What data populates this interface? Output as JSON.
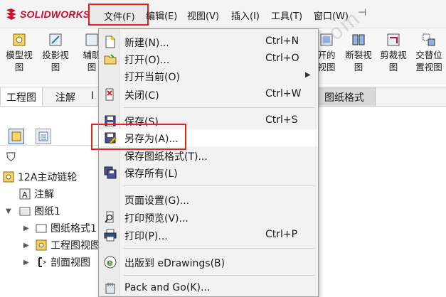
{
  "app": {
    "logo_text": "SOLIDWORKS",
    "brand_color": "#c8102e"
  },
  "menubar": {
    "file": "文件(F)",
    "edit": "编辑(E)",
    "view": "视图(V)",
    "insert": "插入(I)",
    "tools": "工具(T)",
    "window": "窗口(W)",
    "pin_icon": "pin-icon"
  },
  "ribbon": [
    {
      "line1": "模型视",
      "line2": "图"
    },
    {
      "line1": "投影视",
      "line2": "图"
    },
    {
      "line1": "辅助",
      "line2": "图"
    },
    {
      "line1": "开的",
      "line2": "视图"
    },
    {
      "line1": "断裂视",
      "line2": "图"
    },
    {
      "line1": "剪裁视",
      "line2": "图"
    },
    {
      "line1": "交替位",
      "line2": "置视图"
    }
  ],
  "tabs": {
    "drawing": "工程图",
    "annotation": "注解",
    "partial": "I",
    "sheet_format": "图纸格式"
  },
  "tree": {
    "root": "12A主动链轮",
    "annotations": "注解",
    "sheet": "图纸1",
    "sheet_format": "图纸格式1",
    "drawing_view": "工程图视图",
    "section_view": "剖面视图"
  },
  "file_menu": {
    "items": [
      {
        "label": "新建(N)...",
        "shortcut": "Ctrl+N",
        "icon": "new-document-icon"
      },
      {
        "label": "打开(O)...",
        "shortcut": "Ctrl+O",
        "icon": "open-folder-icon"
      },
      {
        "label": "打开当前(O)",
        "shortcut": "",
        "icon": "",
        "submenu": "▶"
      },
      {
        "label": "关闭(C)",
        "shortcut": "Ctrl+W",
        "icon": "close-document-icon"
      },
      {
        "label": "保存(S)",
        "shortcut": "Ctrl+S",
        "icon": "save-icon"
      },
      {
        "label": "另存为(A)...",
        "shortcut": "",
        "icon": "save-as-icon"
      },
      {
        "label": "保存图纸格式(T)...",
        "shortcut": "",
        "icon": ""
      },
      {
        "label": "保存所有(L)",
        "shortcut": "",
        "icon": "save-all-icon"
      },
      {
        "label": "页面设置(G)...",
        "shortcut": "",
        "icon": ""
      },
      {
        "label": "打印预览(V)...",
        "shortcut": "",
        "icon": "print-preview-icon"
      },
      {
        "label": "打印(P)...",
        "shortcut": "Ctrl+P",
        "icon": "printer-icon"
      },
      {
        "label": "出版到 eDrawings(B)",
        "shortcut": "",
        "icon": "edrawings-icon"
      },
      {
        "label": "Pack and Go(K)...",
        "shortcut": "",
        "icon": "pack-and-go-icon"
      }
    ]
  },
  "watermark": "www.zzzsolidworks.com",
  "colors": {
    "highlight_box": "#e0231f",
    "accent_blue": "#3d6fb5"
  }
}
